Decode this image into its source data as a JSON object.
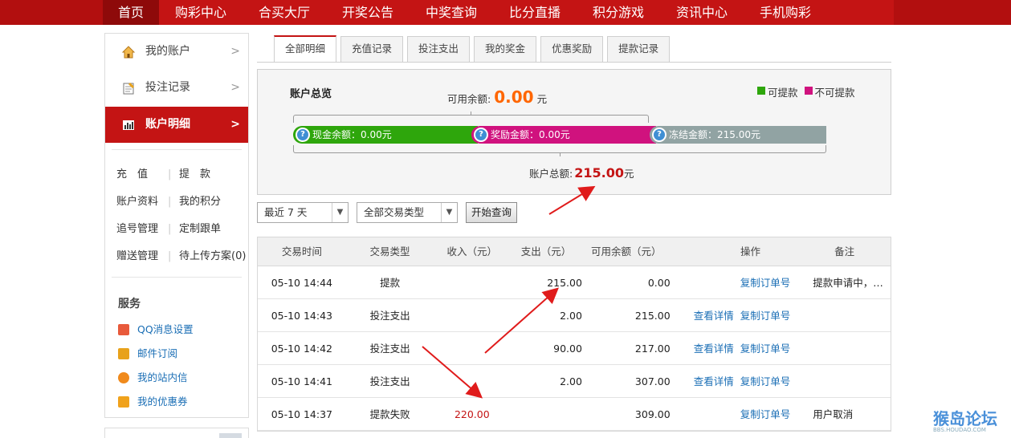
{
  "nav": {
    "items": [
      "首页",
      "购彩中心",
      "合买大厅",
      "开奖公告",
      "中奖查询",
      "比分直播",
      "积分游戏",
      "资讯中心",
      "手机购彩"
    ]
  },
  "sidebar": {
    "menu": [
      {
        "label": "我的账户",
        "icon": "house-icon"
      },
      {
        "label": "投注记录",
        "icon": "notepad-icon"
      },
      {
        "label": "账户明细",
        "icon": "bar-chart-icon"
      }
    ],
    "links": [
      {
        "left": "充　值",
        "right": "提　款"
      },
      {
        "left": "账户资料",
        "right": "我的积分"
      },
      {
        "left": "追号管理",
        "right": "定制跟单"
      },
      {
        "left": "赠送管理",
        "right": "待上传方案(0)"
      }
    ],
    "service_title": "服务",
    "services": [
      {
        "label": "QQ消息设置",
        "icon": "speaker-icon",
        "color": "#e85a3b"
      },
      {
        "label": "邮件订阅",
        "icon": "envelope-icon",
        "color": "#e8a21b"
      },
      {
        "label": "我的站内信",
        "icon": "chat-icon",
        "color": "#f08a1c"
      },
      {
        "label": "我的优惠券",
        "icon": "gift-icon",
        "color": "#f0a21c"
      }
    ]
  },
  "tabs": [
    "全部明细",
    "充值记录",
    "投注支出",
    "我的奖金",
    "优惠奖励",
    "提款记录"
  ],
  "overview": {
    "title": "账户总览",
    "legend_withdrawable": "可提款",
    "legend_non_withdrawable": "不可提款",
    "colors": {
      "withdrawable": "#2ea60c",
      "non_withdrawable": "#d0127e"
    },
    "available_label": "可用余额:",
    "available_value": "0.00",
    "unit": "元",
    "cash_label": "现金余额：0.00元",
    "bonus_label": "奖励金额：0.00元",
    "frozen_label": "冻结金额：215.00元",
    "total_label": "账户总额:",
    "total_value": "215.00"
  },
  "filters": {
    "period": "最近 7 天",
    "type": "全部交易类型",
    "query_button": "开始查询"
  },
  "table": {
    "headers": [
      "交易时间",
      "交易类型",
      "收入（元）",
      "支出（元）",
      "可用余额（元）",
      "操作",
      "备注"
    ],
    "rows": [
      {
        "time": "05-10 14:44",
        "type": "提款",
        "income": "",
        "expense": "215.00",
        "balance": "0.00",
        "detail": "",
        "copy": "复制订单号",
        "note": "提款申请中，…"
      },
      {
        "time": "05-10 14:43",
        "type": "投注支出",
        "income": "",
        "expense": "2.00",
        "balance": "215.00",
        "detail": "查看详情",
        "copy": "复制订单号",
        "note": ""
      },
      {
        "time": "05-10 14:42",
        "type": "投注支出",
        "income": "",
        "expense": "90.00",
        "balance": "217.00",
        "detail": "查看详情",
        "copy": "复制订单号",
        "note": ""
      },
      {
        "time": "05-10 14:41",
        "type": "投注支出",
        "income": "",
        "expense": "2.00",
        "balance": "307.00",
        "detail": "查看详情",
        "copy": "复制订单号",
        "note": ""
      },
      {
        "time": "05-10 14:37",
        "type": "提款失败",
        "income": "220.00",
        "expense": "",
        "balance": "309.00",
        "detail": "",
        "copy": "复制订单号",
        "note": "用户取消"
      }
    ]
  },
  "watermark": {
    "title": "猴岛论坛",
    "sub": "BBS.HOUDAO.COM"
  }
}
